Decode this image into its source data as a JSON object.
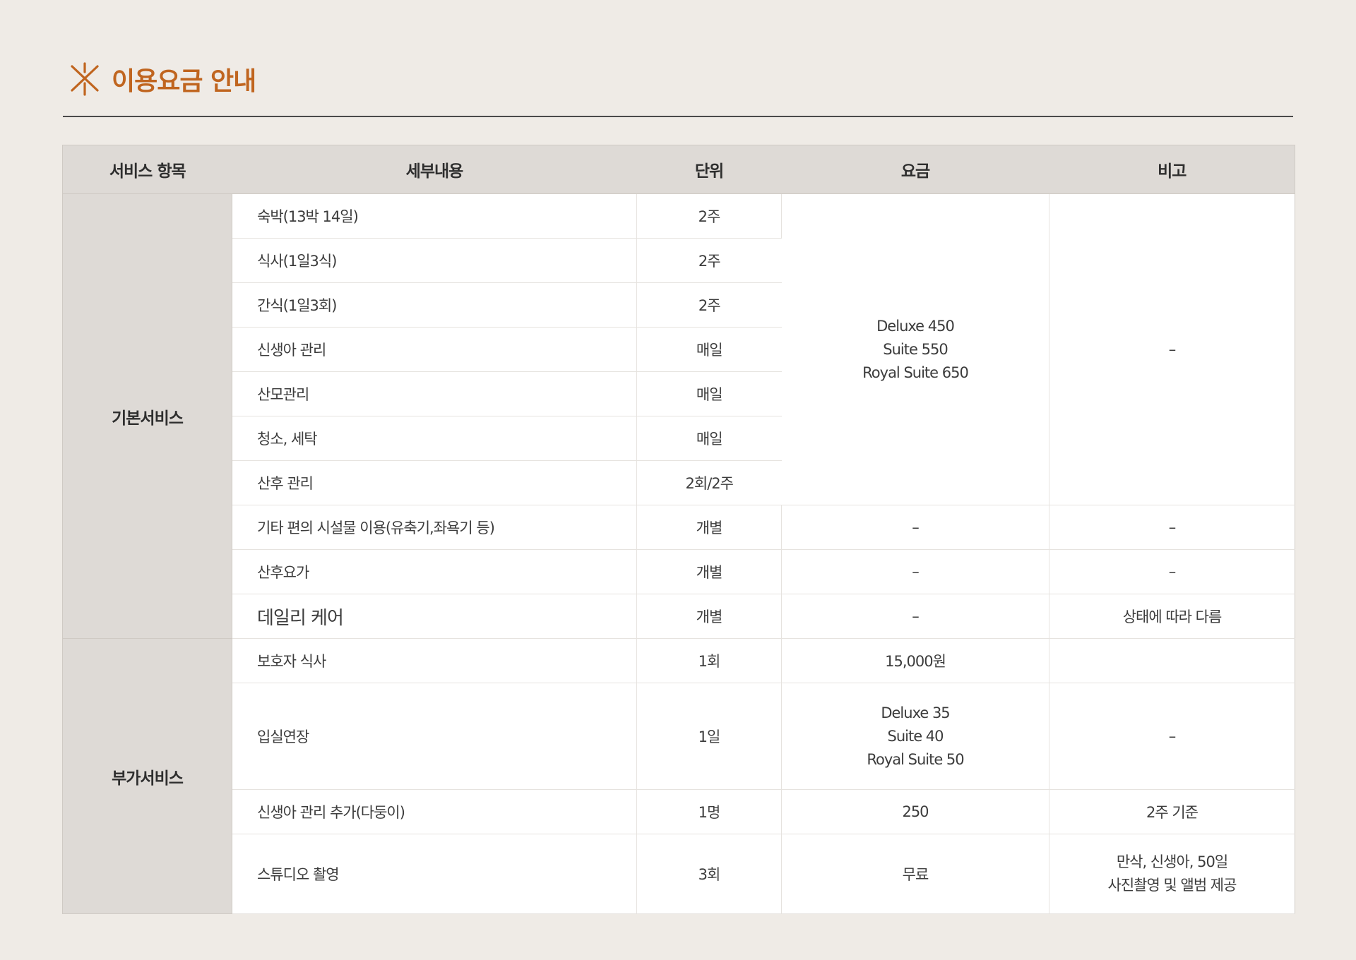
{
  "header": {
    "title": "이용요금 안내",
    "icon": "sparkle-icon",
    "accent_color": "#c0651f"
  },
  "table": {
    "columns": [
      "서비스 항목",
      "세부내용",
      "단위",
      "요금",
      "비고"
    ],
    "basic": {
      "category": "기본서비스",
      "rows": [
        {
          "detail": "숙박(13박 14일)",
          "unit": "2주"
        },
        {
          "detail": "식사(1일3식)",
          "unit": "2주"
        },
        {
          "detail": "간식(1일3회)",
          "unit": "2주"
        },
        {
          "detail": "신생아 관리",
          "unit": "매일"
        },
        {
          "detail": "산모관리",
          "unit": "매일"
        },
        {
          "detail": "청소, 세탁",
          "unit": "매일"
        },
        {
          "detail": "산후 관리",
          "unit": "2회/2주"
        }
      ],
      "grouped_price": [
        "Deluxe 450",
        "Suite 550",
        "Royal Suite 650"
      ],
      "grouped_note": "–",
      "extra_rows": [
        {
          "detail": "기타 편의 시설물 이용(유축기,좌욕기 등)",
          "unit": "개별",
          "price": "–",
          "note": "–"
        },
        {
          "detail": "산후요가",
          "unit": "개별",
          "price": "–",
          "note": "–"
        },
        {
          "detail": "데일리 케어",
          "unit": "개별",
          "price": "–",
          "note": "상태에 따라 다름"
        }
      ]
    },
    "additional": {
      "category": "부가서비스",
      "rows": [
        {
          "detail": "보호자 식사",
          "unit": "1회",
          "price": "15,000원",
          "note": ""
        },
        {
          "detail": "입실연장",
          "unit": "1일",
          "price_lines": [
            "Deluxe 35",
            "Suite 40",
            "Royal Suite 50"
          ],
          "note": "–"
        },
        {
          "detail": "신생아 관리 추가(다둥이)",
          "unit": "1명",
          "price": "250",
          "note": "2주 기준"
        },
        {
          "detail": "스튜디오 촬영",
          "unit": "3회",
          "price": "무료",
          "note_lines": [
            "만삭, 신생아, 50일",
            "사진촬영 및 앨범 제공"
          ]
        }
      ]
    }
  }
}
